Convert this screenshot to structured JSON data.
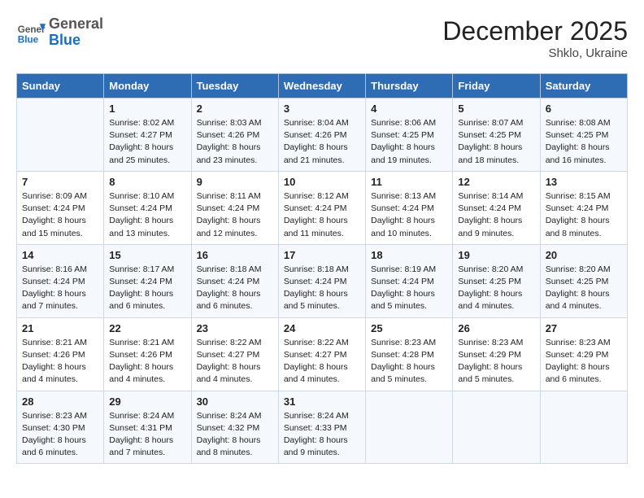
{
  "logo": {
    "general": "General",
    "blue": "Blue"
  },
  "header": {
    "month": "December 2025",
    "location": "Shklo, Ukraine"
  },
  "weekdays": [
    "Sunday",
    "Monday",
    "Tuesday",
    "Wednesday",
    "Thursday",
    "Friday",
    "Saturday"
  ],
  "weeks": [
    [
      {
        "day": "",
        "info": ""
      },
      {
        "day": "1",
        "info": "Sunrise: 8:02 AM\nSunset: 4:27 PM\nDaylight: 8 hours\nand 25 minutes."
      },
      {
        "day": "2",
        "info": "Sunrise: 8:03 AM\nSunset: 4:26 PM\nDaylight: 8 hours\nand 23 minutes."
      },
      {
        "day": "3",
        "info": "Sunrise: 8:04 AM\nSunset: 4:26 PM\nDaylight: 8 hours\nand 21 minutes."
      },
      {
        "day": "4",
        "info": "Sunrise: 8:06 AM\nSunset: 4:25 PM\nDaylight: 8 hours\nand 19 minutes."
      },
      {
        "day": "5",
        "info": "Sunrise: 8:07 AM\nSunset: 4:25 PM\nDaylight: 8 hours\nand 18 minutes."
      },
      {
        "day": "6",
        "info": "Sunrise: 8:08 AM\nSunset: 4:25 PM\nDaylight: 8 hours\nand 16 minutes."
      }
    ],
    [
      {
        "day": "7",
        "info": "Sunrise: 8:09 AM\nSunset: 4:24 PM\nDaylight: 8 hours\nand 15 minutes."
      },
      {
        "day": "8",
        "info": "Sunrise: 8:10 AM\nSunset: 4:24 PM\nDaylight: 8 hours\nand 13 minutes."
      },
      {
        "day": "9",
        "info": "Sunrise: 8:11 AM\nSunset: 4:24 PM\nDaylight: 8 hours\nand 12 minutes."
      },
      {
        "day": "10",
        "info": "Sunrise: 8:12 AM\nSunset: 4:24 PM\nDaylight: 8 hours\nand 11 minutes."
      },
      {
        "day": "11",
        "info": "Sunrise: 8:13 AM\nSunset: 4:24 PM\nDaylight: 8 hours\nand 10 minutes."
      },
      {
        "day": "12",
        "info": "Sunrise: 8:14 AM\nSunset: 4:24 PM\nDaylight: 8 hours\nand 9 minutes."
      },
      {
        "day": "13",
        "info": "Sunrise: 8:15 AM\nSunset: 4:24 PM\nDaylight: 8 hours\nand 8 minutes."
      }
    ],
    [
      {
        "day": "14",
        "info": "Sunrise: 8:16 AM\nSunset: 4:24 PM\nDaylight: 8 hours\nand 7 minutes."
      },
      {
        "day": "15",
        "info": "Sunrise: 8:17 AM\nSunset: 4:24 PM\nDaylight: 8 hours\nand 6 minutes."
      },
      {
        "day": "16",
        "info": "Sunrise: 8:18 AM\nSunset: 4:24 PM\nDaylight: 8 hours\nand 6 minutes."
      },
      {
        "day": "17",
        "info": "Sunrise: 8:18 AM\nSunset: 4:24 PM\nDaylight: 8 hours\nand 5 minutes."
      },
      {
        "day": "18",
        "info": "Sunrise: 8:19 AM\nSunset: 4:24 PM\nDaylight: 8 hours\nand 5 minutes."
      },
      {
        "day": "19",
        "info": "Sunrise: 8:20 AM\nSunset: 4:25 PM\nDaylight: 8 hours\nand 4 minutes."
      },
      {
        "day": "20",
        "info": "Sunrise: 8:20 AM\nSunset: 4:25 PM\nDaylight: 8 hours\nand 4 minutes."
      }
    ],
    [
      {
        "day": "21",
        "info": "Sunrise: 8:21 AM\nSunset: 4:26 PM\nDaylight: 8 hours\nand 4 minutes."
      },
      {
        "day": "22",
        "info": "Sunrise: 8:21 AM\nSunset: 4:26 PM\nDaylight: 8 hours\nand 4 minutes."
      },
      {
        "day": "23",
        "info": "Sunrise: 8:22 AM\nSunset: 4:27 PM\nDaylight: 8 hours\nand 4 minutes."
      },
      {
        "day": "24",
        "info": "Sunrise: 8:22 AM\nSunset: 4:27 PM\nDaylight: 8 hours\nand 4 minutes."
      },
      {
        "day": "25",
        "info": "Sunrise: 8:23 AM\nSunset: 4:28 PM\nDaylight: 8 hours\nand 5 minutes."
      },
      {
        "day": "26",
        "info": "Sunrise: 8:23 AM\nSunset: 4:29 PM\nDaylight: 8 hours\nand 5 minutes."
      },
      {
        "day": "27",
        "info": "Sunrise: 8:23 AM\nSunset: 4:29 PM\nDaylight: 8 hours\nand 6 minutes."
      }
    ],
    [
      {
        "day": "28",
        "info": "Sunrise: 8:23 AM\nSunset: 4:30 PM\nDaylight: 8 hours\nand 6 minutes."
      },
      {
        "day": "29",
        "info": "Sunrise: 8:24 AM\nSunset: 4:31 PM\nDaylight: 8 hours\nand 7 minutes."
      },
      {
        "day": "30",
        "info": "Sunrise: 8:24 AM\nSunset: 4:32 PM\nDaylight: 8 hours\nand 8 minutes."
      },
      {
        "day": "31",
        "info": "Sunrise: 8:24 AM\nSunset: 4:33 PM\nDaylight: 8 hours\nand 9 minutes."
      },
      {
        "day": "",
        "info": ""
      },
      {
        "day": "",
        "info": ""
      },
      {
        "day": "",
        "info": ""
      }
    ]
  ]
}
